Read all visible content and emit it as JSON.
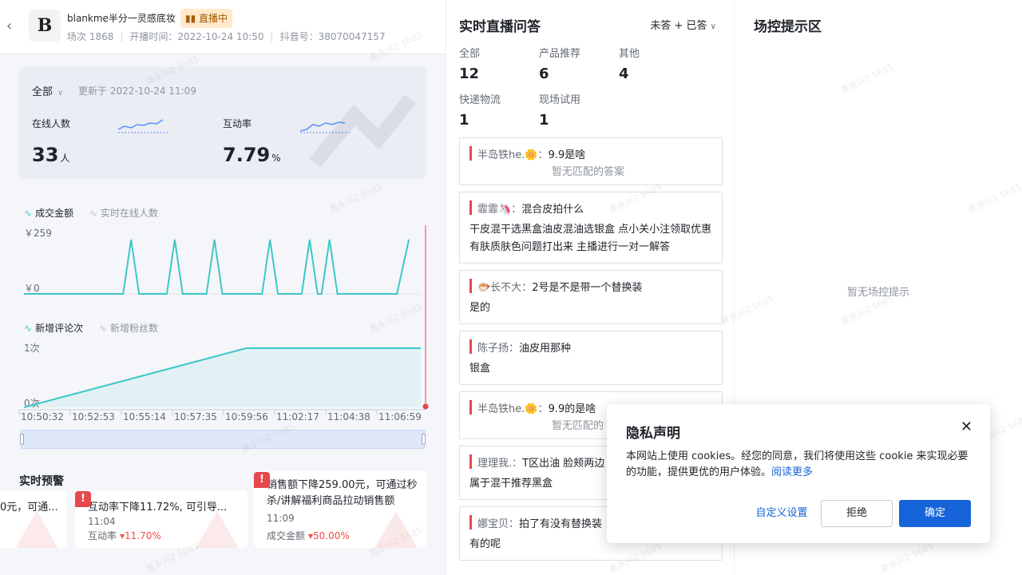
{
  "header": {
    "store_name": "blankme半分一灵感底妆",
    "live_badge": "直播中",
    "live_badge_icon": "bar-chart-icon",
    "session": "场次 1868",
    "start_time": "开播时间：2022-10-24 10:50",
    "douyin_id": "抖音号：38070047157"
  },
  "stats": {
    "filter": "全部",
    "updated": "更新于 2022-10-24 11:09",
    "online_label": "在线人数",
    "online_value": "33",
    "online_unit": "人",
    "interact_label": "互动率",
    "interact_value": "7.79",
    "interact_unit": "%"
  },
  "chart1": {
    "legend_primary": "成交金额",
    "legend_secondary": "实时在线人数",
    "y_max_label": "￥259",
    "y_min_label": "￥0"
  },
  "chart2": {
    "legend_primary": "新增评论次",
    "legend_secondary": "新增粉丝数",
    "y_max_label": "1次",
    "y_min_label": "0次"
  },
  "chart_data": [
    {
      "type": "line",
      "x": [
        "10:50:32",
        "10:52:53",
        "10:55:14",
        "10:57:35",
        "10:59:56",
        "11:02:17",
        "11:04:38",
        "11:06:59"
      ],
      "series": [
        {
          "name": "成交金额",
          "points": [
            [
              0,
              0
            ],
            [
              0.25,
              0
            ],
            [
              0.27,
              259
            ],
            [
              0.29,
              0
            ],
            [
              0.36,
              0
            ],
            [
              0.38,
              259
            ],
            [
              0.4,
              0
            ],
            [
              0.46,
              0
            ],
            [
              0.48,
              259
            ],
            [
              0.5,
              0
            ],
            [
              0.6,
              0
            ],
            [
              0.62,
              259
            ],
            [
              0.64,
              0
            ],
            [
              0.7,
              0
            ],
            [
              0.72,
              259
            ],
            [
              0.74,
              0
            ],
            [
              0.75,
              0
            ],
            [
              0.77,
              259
            ],
            [
              0.79,
              0
            ],
            [
              0.94,
              0
            ],
            [
              0.97,
              259
            ]
          ]
        }
      ],
      "ylim": [
        0,
        259
      ],
      "color": "#3ec7c7"
    },
    {
      "type": "area",
      "x": [
        "10:50:32",
        "10:52:53",
        "10:55:14",
        "10:57:35",
        "10:59:56",
        "11:02:17",
        "11:04:38",
        "11:06:59"
      ],
      "series": [
        {
          "name": "新增评论次",
          "points": [
            [
              0,
              0
            ],
            [
              0.56,
              1
            ],
            [
              1,
              1
            ]
          ]
        }
      ],
      "ylim": [
        0,
        1
      ],
      "color": "#3ec7c7"
    }
  ],
  "alerts": {
    "title": "实时预警",
    "cards": [
      {
        "text": "0元，可通...",
        "time": "",
        "metric": "",
        "change": ""
      },
      {
        "text": "互动率下降11.72%, 可引导...",
        "time": "11:04",
        "metric": "互动率",
        "change": "11.70%"
      },
      {
        "text": "销售额下降259.00元，可通过秒杀/讲解福利商品拉动销售额",
        "time": "11:09",
        "metric": "成交金额",
        "change": "50.00%"
      }
    ]
  },
  "qa": {
    "title": "实时直播问答",
    "filter": "未答 + 已答",
    "categories": [
      {
        "label": "全部",
        "count": "12"
      },
      {
        "label": "产品推荐",
        "count": "6"
      },
      {
        "label": "其他",
        "count": "4"
      },
      {
        "label": "快递物流",
        "count": "1"
      },
      {
        "label": "现场试用",
        "count": "1"
      }
    ],
    "items": [
      {
        "user": "半岛铁he.🌼：",
        "question": "9.9是啥",
        "answer": "",
        "none": "暂无匹配的答案"
      },
      {
        "user": "霏霏🦄：",
        "question": "混合皮拍什么",
        "answer": "干皮混干选黑盒油皮混油选银盒 点小关小注领取优惠 有肤质肤色问题打出来 主播进行一对一解答",
        "none": ""
      },
      {
        "user": "🐡长不大：",
        "question": "2号是不是带一个替换装",
        "answer": "是的",
        "none": ""
      },
      {
        "user": "陈子扬：",
        "question": "油皮用那种",
        "answer": "银盒",
        "none": ""
      },
      {
        "user": "半岛铁he.🌼：",
        "question": "9.9的是啥",
        "answer": "",
        "none": "暂无匹配的"
      },
      {
        "user": "理理我.：",
        "question": "T区出油 脸颊两边",
        "answer": "属于混干推荐黑盒",
        "none": ""
      },
      {
        "user": "娜宝贝：",
        "question": "拍了有没有替换装",
        "answer": "有的呢",
        "none": ""
      }
    ]
  },
  "control": {
    "title": "场控提示区",
    "empty": "暂无场控提示"
  },
  "privacy": {
    "title": "隐私声明",
    "body": "本网站上使用 cookies。经您的同意，我们将使用这些 cookie 来实现必要的功能，提供更优的用户体验。",
    "link": "阅读更多",
    "customize": "自定义设置",
    "reject": "拒绝",
    "accept": "确定"
  },
  "watermark": "黄永兴2 5685",
  "colors": {
    "accent": "#3ec7c7",
    "primary": "#1664d9",
    "alert": "#e5484d"
  }
}
